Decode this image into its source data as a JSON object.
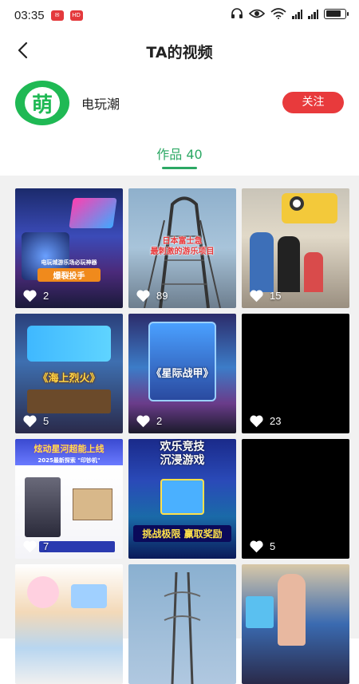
{
  "status_bar": {
    "time": "03:35",
    "badge_text": "HD"
  },
  "nav": {
    "title": "TA的视频"
  },
  "profile": {
    "avatar_text": "萌",
    "name": "电玩潮",
    "follow_label": "关注"
  },
  "tabs": {
    "works_label": "作品 40"
  },
  "videos": [
    {
      "likes": "2",
      "caption": "爆裂投手",
      "sub": "电玩城游乐场必玩神器"
    },
    {
      "likes": "89",
      "caption": "日本富士急\n最刺激的游乐项目"
    },
    {
      "likes": "15"
    },
    {
      "likes": "5",
      "caption": "《海上烈火》"
    },
    {
      "likes": "2",
      "caption": "《星际战甲》"
    },
    {
      "likes": "23"
    },
    {
      "likes": "7",
      "caption": "炫动星河超能上线",
      "sub": "2025最新探索 \"印钞机\""
    },
    {
      "likes": "",
      "caption": "欢乐竞技\n沉浸游戏",
      "sub": "挑战极限 赢取奖励"
    },
    {
      "likes": "5"
    },
    {
      "likes": ""
    },
    {
      "likes": ""
    },
    {
      "likes": ""
    }
  ]
}
